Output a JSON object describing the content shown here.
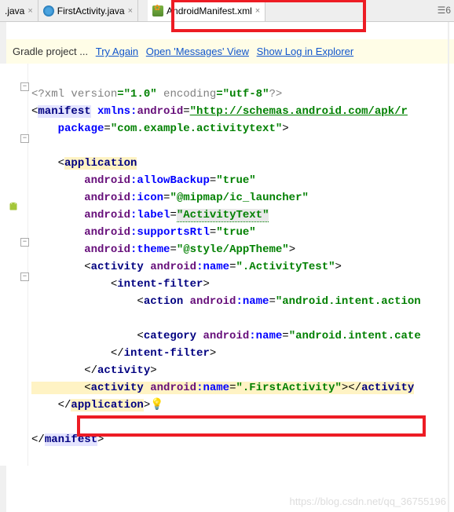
{
  "tabs": {
    "t0": {
      "label": ".java"
    },
    "t1": {
      "label": "FirstActivity.java"
    },
    "t2": {
      "label": "AndroidManifest.xml"
    }
  },
  "tabctrl": "☰6",
  "notif": {
    "prefix": "Gradle project ...",
    "link1": "Try Again",
    "link2": "Open 'Messages' View",
    "link3": "Show Log in Explorer"
  },
  "code": {
    "l1a": "<?xml ",
    "l1b": "version",
    "l1c": "=\"1.0\" ",
    "l1d": "encoding",
    "l1e": "=\"utf-8\"",
    "l1f": "?>",
    "l2a": "<",
    "l2b": "manifest",
    "l2c": " xmlns:",
    "l2d": "android",
    "l2e": "=",
    "l2f": "\"http://schemas.android.com/apk/r",
    "l3a": "    ",
    "l3b": "package",
    "l3c": "=",
    "l3d": "\"com.example.activitytext\"",
    "l3e": ">",
    "l5a": "    <",
    "l5b": "application",
    "l6a": "        ",
    "l6b": "android",
    "l6c": ":allowBackup",
    "l6d": "=",
    "l6e": "\"true\"",
    "l7a": "        ",
    "l7b": "android",
    "l7c": ":icon",
    "l7d": "=",
    "l7e": "\"@mipmap/ic_launcher\"",
    "l8a": "        ",
    "l8b": "android",
    "l8c": ":label",
    "l8d": "=",
    "l8e": "\"ActivityText\"",
    "l9a": "        ",
    "l9b": "android",
    "l9c": ":supportsRtl",
    "l9d": "=",
    "l9e": "\"true\"",
    "l10a": "        ",
    "l10b": "android",
    "l10c": ":theme",
    "l10d": "=",
    "l10e": "\"@style/AppTheme\"",
    "l10f": ">",
    "l11a": "        <",
    "l11b": "activity ",
    "l11c": "android",
    "l11d": ":name",
    "l11e": "=",
    "l11f": "\".ActivityTest\"",
    "l11g": ">",
    "l12a": "            <",
    "l12b": "intent-filter",
    "l12c": ">",
    "l13a": "                <",
    "l13b": "action ",
    "l13c": "android",
    "l13d": ":name",
    "l13e": "=",
    "l13f": "\"android.intent.action",
    "l15a": "                <",
    "l15b": "category ",
    "l15c": "android",
    "l15d": ":name",
    "l15e": "=",
    "l15f": "\"android.intent.cate",
    "l16a": "            </",
    "l16b": "intent-filter",
    "l16c": ">",
    "l17a": "        </",
    "l17b": "activity",
    "l17c": ">",
    "l18a": "        <",
    "l18b": "activity ",
    "l18c": "android",
    "l18d": ":name",
    "l18e": "=",
    "l18f": "\".FirstActivity\"",
    "l18g": "></",
    "l18h": "activity",
    "l19a": "    </",
    "l19b": "application",
    "l19c": ">",
    "l21a": "</",
    "l21b": "manifest",
    "l21c": ">"
  },
  "watermark": "https://blog.csdn.net/qq_36755196"
}
